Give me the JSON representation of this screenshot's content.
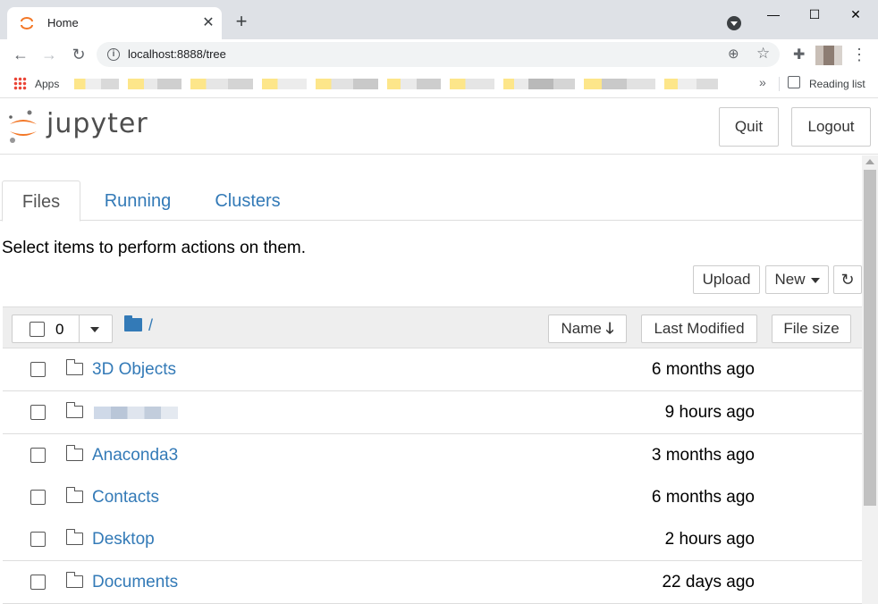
{
  "browser": {
    "tab_title": "Home",
    "url": "localhost:8888/tree",
    "bookmarks": {
      "apps_label": "Apps",
      "reading_list_label": "Reading list"
    }
  },
  "jupyter": {
    "logo_text": "jupyter",
    "header_buttons": {
      "quit": "Quit",
      "logout": "Logout"
    },
    "tabs": [
      {
        "label": "Files",
        "active": true
      },
      {
        "label": "Running",
        "active": false
      },
      {
        "label": "Clusters",
        "active": false
      }
    ],
    "hint": "Select items to perform actions on them.",
    "actions": {
      "upload": "Upload",
      "new": "New"
    },
    "list_header": {
      "selected_count": "0",
      "breadcrumb": "/",
      "sort_name": "Name",
      "sort_modified": "Last Modified",
      "sort_size": "File size"
    },
    "files": [
      {
        "name": "3D Objects",
        "modified": "6 months ago",
        "type": "folder"
      },
      {
        "name": "",
        "modified": "9 hours ago",
        "type": "folder"
      },
      {
        "name": "Anaconda3",
        "modified": "3 months ago",
        "type": "folder"
      },
      {
        "name": "Contacts",
        "modified": "6 months ago",
        "type": "folder"
      },
      {
        "name": "Desktop",
        "modified": "2 hours ago",
        "type": "folder"
      },
      {
        "name": "Documents",
        "modified": "22 days ago",
        "type": "folder"
      }
    ]
  },
  "colors": {
    "link": "#337ab7",
    "jupyter_orange": "#f37726",
    "chrome_tabstrip": "#dee1e6"
  }
}
